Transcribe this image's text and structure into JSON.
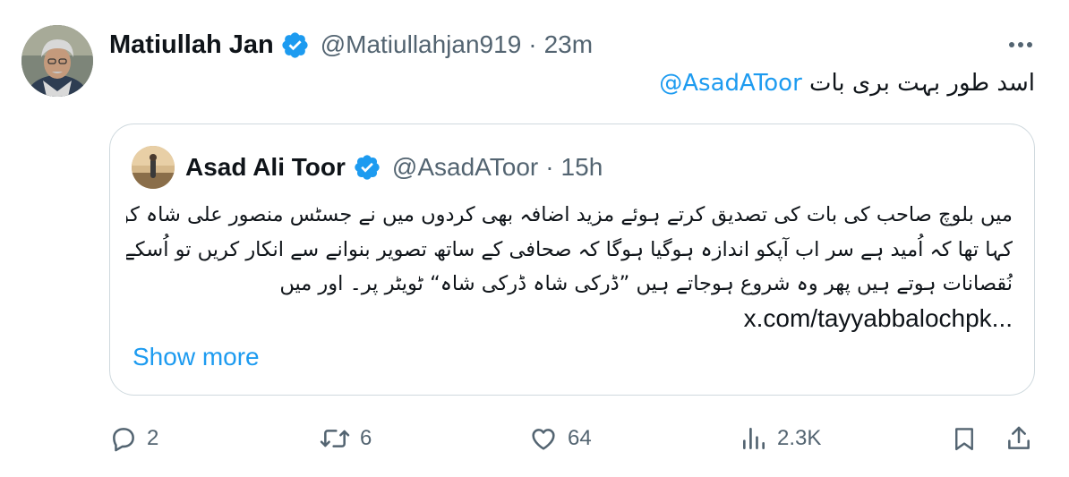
{
  "author": {
    "name": "Matiullah Jan",
    "handle": "@Matiullahjan919",
    "separator": "·",
    "time": "23m",
    "verified_icon": "verified-badge-icon"
  },
  "tweet": {
    "text_urdu": "اسد طور بہت بری بات",
    "mention": "@AsadAToor"
  },
  "quoted": {
    "name": "Asad Ali Toor",
    "handle": "@AsadAToor",
    "separator": "·",
    "time": "15h",
    "lines": [
      "میں بلوچ صاحب کی بات کی تصدیق کرتے ہوئے مزید اضافہ بھی کردوں میں نے جسٹس منصور علی شاہ کو بھی",
      "کہا تھا کہ اُمید ہے سر اب آپکو اندازہ ہوگیا ہوگا کہ صحافی کے ساتھ تصویر بنوانے سے انکار کریں تو اُسکے کیا",
      "نُقصانات ہوتے ہیں پھر وہ شروع ہوجاتے ہیں ”ڈرکی شاہ ڈرکی شاہ“ ٹویٹر پر۔ اور میں"
    ],
    "link": "x.com/tayyabbalochpk...",
    "show_more": "Show more"
  },
  "actions": {
    "reply_count": "2",
    "retweet_count": "6",
    "like_count": "64",
    "views_count": "2.3K"
  },
  "colors": {
    "accent": "#1d9bf0",
    "secondary_text": "#536471",
    "border": "#cfd9de"
  }
}
